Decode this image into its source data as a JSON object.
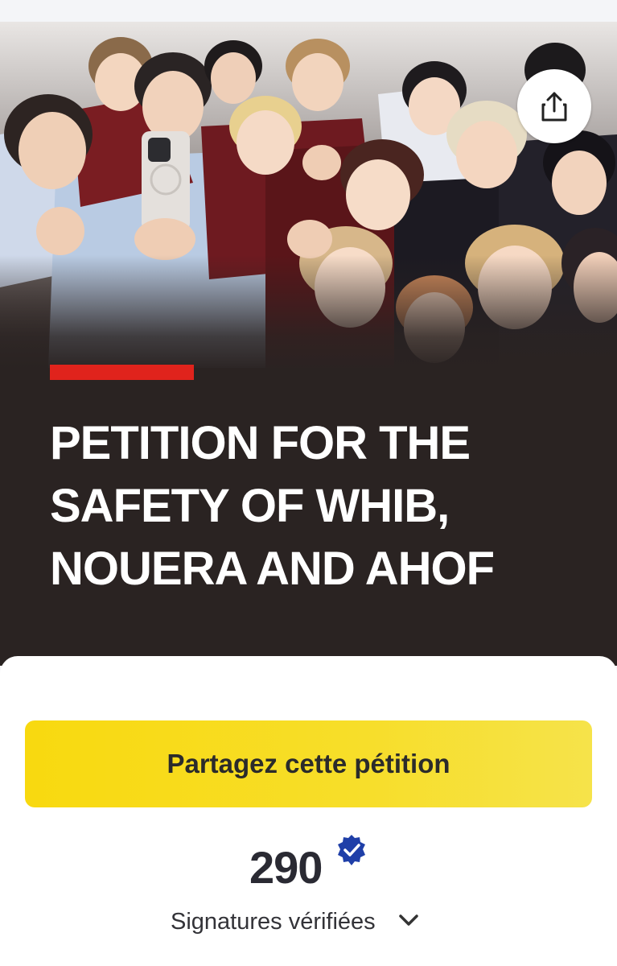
{
  "petition": {
    "title": "PETITION FOR THE SAFETY OF WHIB, NOUERA AND AHOF",
    "image": "group-photo"
  },
  "header": {
    "share_icon": "share-icon"
  },
  "actions": {
    "share_label": "Partagez cette pétition"
  },
  "signatures": {
    "count": "290",
    "label": "Signatures vérifiées",
    "verified_icon": "verified-badge-icon",
    "toggle_icon": "chevron-down-icon"
  },
  "colors": {
    "hero_bg": "#2a2322",
    "accent": "#e0231c",
    "cta": "#f8d90f",
    "verified": "#1f3fa8"
  }
}
